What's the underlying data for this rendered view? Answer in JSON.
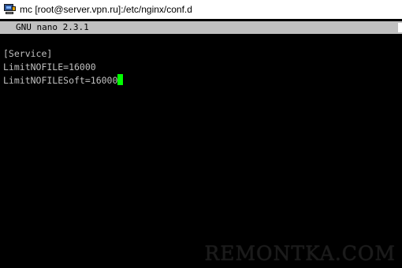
{
  "window": {
    "title": "mc [root@server.vpn.ru]:/etc/nginx/conf.d",
    "app_icon": "putty-terminal-icon"
  },
  "nano": {
    "header": "GNU nano 2.3.1"
  },
  "editor": {
    "lines": [
      "[Service]",
      "LimitNOFILE=16000",
      "LimitNOFILESoft=16000"
    ],
    "cursor_color": "#00ff00",
    "text_color": "#c0c0c0",
    "background": "#000000"
  },
  "watermark": {
    "text": "REMONTKA.COM"
  }
}
